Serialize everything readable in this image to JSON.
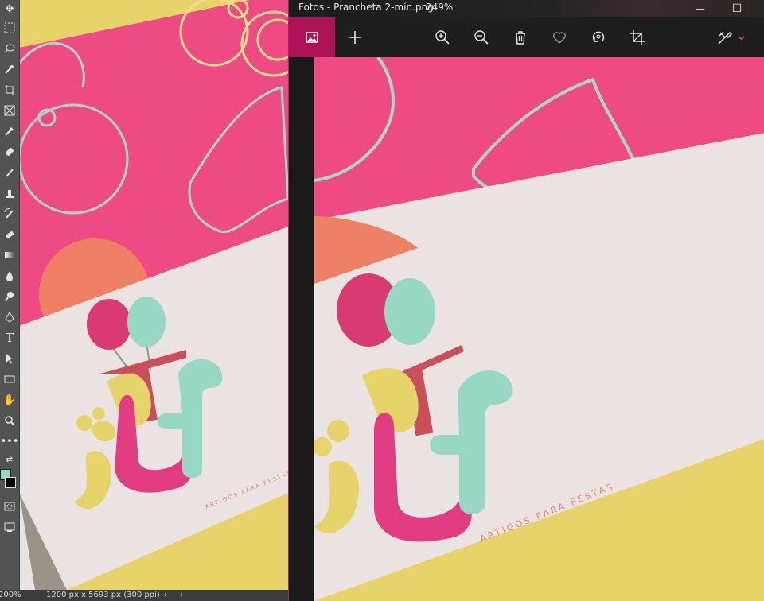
{
  "photoshop": {
    "status": {
      "zoom": "200%",
      "doc_info": "1200 px x 5693 px (300 ppi)",
      "arrow": "›",
      "scroll_left": "‹"
    },
    "tools": [
      "move-tool-icon",
      "marquee-tool-icon",
      "lasso-tool-icon",
      "quick-select-tool-icon",
      "crop-tool-icon",
      "frame-tool-icon",
      "eyedropper-tool-icon",
      "healing-tool-icon",
      "brush-tool-icon",
      "stamp-tool-icon",
      "history-brush-icon",
      "eraser-tool-icon",
      "gradient-tool-icon",
      "blur-tool-icon",
      "dodge-tool-icon",
      "pen-tool-icon",
      "type-tool-icon",
      "path-select-tool-icon",
      "rectangle-tool-icon",
      "hand-tool-icon",
      "zoom-tool-icon",
      "more-tools-icon"
    ],
    "type_tool_label": "T",
    "artwork_tagline": "ARTIGOS PARA FESTAS"
  },
  "photos": {
    "title": "Fotos - Prancheta 2-min.png",
    "zoom": "249%",
    "window_controls": {
      "minimize": "—",
      "maximize": "☐"
    },
    "commands": [
      "image-icon",
      "add-icon",
      "zoom-in-icon",
      "zoom-out-icon",
      "delete-icon",
      "favorite-icon",
      "rotate-icon",
      "crop-icon",
      "edit-icon"
    ],
    "artwork_tagline": "ARTIGOS PARA FESTAS"
  },
  "colors": {
    "pink_bg": "#ee4a84",
    "box_white": "#ebe3e1",
    "yellow": "#e6d46a",
    "mint": "#97d8c4",
    "magenta": "#e23d83",
    "balloon_pink": "#d93a73",
    "dark_red": "#c94f5b",
    "orange": "#ee8065",
    "outline": "#a8d6cb",
    "outline_yellow": "#f2df8a",
    "accent": "#ad1457"
  }
}
